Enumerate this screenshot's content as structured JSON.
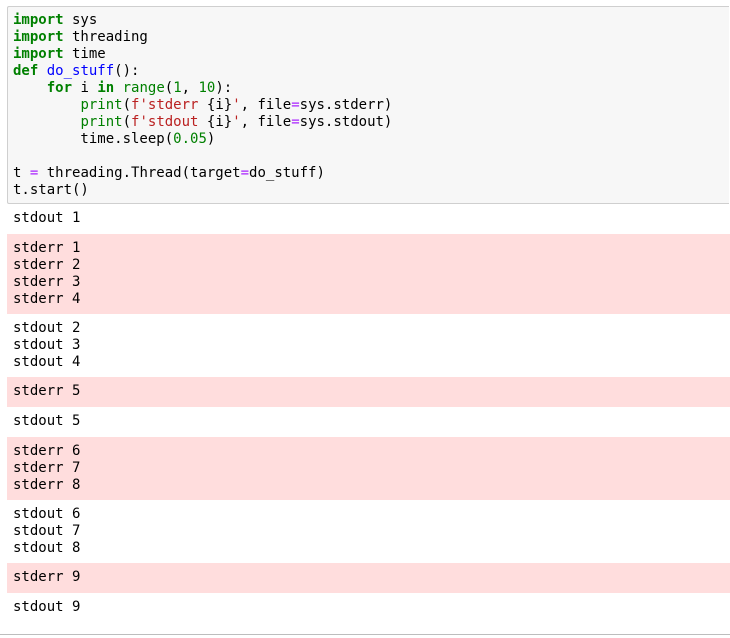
{
  "code_cell": {
    "lines": [
      [
        {
          "t": "import",
          "c": "kw"
        },
        {
          "t": " sys",
          "c": ""
        }
      ],
      [
        {
          "t": "import",
          "c": "kw"
        },
        {
          "t": " threading",
          "c": ""
        }
      ],
      [
        {
          "t": "import",
          "c": "kw"
        },
        {
          "t": " time",
          "c": ""
        }
      ],
      [
        {
          "t": "def",
          "c": "kw"
        },
        {
          "t": " ",
          "c": ""
        },
        {
          "t": "do_stuff",
          "c": "fn"
        },
        {
          "t": "():",
          "c": ""
        }
      ],
      [
        {
          "t": "    ",
          "c": ""
        },
        {
          "t": "for",
          "c": "kw"
        },
        {
          "t": " i ",
          "c": ""
        },
        {
          "t": "in",
          "c": "kw"
        },
        {
          "t": " ",
          "c": ""
        },
        {
          "t": "range",
          "c": "bi"
        },
        {
          "t": "(",
          "c": ""
        },
        {
          "t": "1",
          "c": "num"
        },
        {
          "t": ", ",
          "c": ""
        },
        {
          "t": "10",
          "c": "num"
        },
        {
          "t": "):",
          "c": ""
        }
      ],
      [
        {
          "t": "        ",
          "c": ""
        },
        {
          "t": "print",
          "c": "bi"
        },
        {
          "t": "(",
          "c": ""
        },
        {
          "t": "f'stderr ",
          "c": "str"
        },
        {
          "t": "{i}",
          "c": ""
        },
        {
          "t": "'",
          "c": "str"
        },
        {
          "t": ", file",
          "c": ""
        },
        {
          "t": "=",
          "c": "op"
        },
        {
          "t": "sys.stderr)",
          "c": ""
        }
      ],
      [
        {
          "t": "        ",
          "c": ""
        },
        {
          "t": "print",
          "c": "bi"
        },
        {
          "t": "(",
          "c": ""
        },
        {
          "t": "f'stdout ",
          "c": "str"
        },
        {
          "t": "{i}",
          "c": ""
        },
        {
          "t": "'",
          "c": "str"
        },
        {
          "t": ", file",
          "c": ""
        },
        {
          "t": "=",
          "c": "op"
        },
        {
          "t": "sys.stdout)",
          "c": ""
        }
      ],
      [
        {
          "t": "        time.sleep(",
          "c": ""
        },
        {
          "t": "0.05",
          "c": "num"
        },
        {
          "t": ")",
          "c": ""
        }
      ],
      [
        {
          "t": "",
          "c": ""
        }
      ],
      [
        {
          "t": "t ",
          "c": ""
        },
        {
          "t": "=",
          "c": "op"
        },
        {
          "t": " threading.Thread(target",
          "c": ""
        },
        {
          "t": "=",
          "c": "op"
        },
        {
          "t": "do_stuff)",
          "c": ""
        }
      ],
      [
        {
          "t": "t.start()",
          "c": ""
        }
      ]
    ]
  },
  "outputs": [
    {
      "stream": "stdout",
      "lines": [
        "stdout 1"
      ]
    },
    {
      "stream": "stderr",
      "lines": [
        "stderr 1",
        "stderr 2",
        "stderr 3",
        "stderr 4"
      ]
    },
    {
      "stream": "stdout",
      "lines": [
        "stdout 2",
        "stdout 3",
        "stdout 4"
      ]
    },
    {
      "stream": "stderr",
      "lines": [
        "stderr 5"
      ]
    },
    {
      "stream": "stdout",
      "lines": [
        "stdout 5"
      ]
    },
    {
      "stream": "stderr",
      "lines": [
        "stderr 6",
        "stderr 7",
        "stderr 8"
      ]
    },
    {
      "stream": "stdout",
      "lines": [
        "stdout 6",
        "stdout 7",
        "stdout 8"
      ]
    },
    {
      "stream": "stderr",
      "lines": [
        "stderr 9"
      ]
    },
    {
      "stream": "stdout",
      "lines": [
        "stdout 9"
      ]
    }
  ],
  "colors": {
    "code_background": "#f7f7f7",
    "stderr_background": "#ffdddd",
    "keyword": "#008000",
    "function_name": "#0000ff",
    "string": "#ba2121",
    "operator": "#aa22ff"
  }
}
